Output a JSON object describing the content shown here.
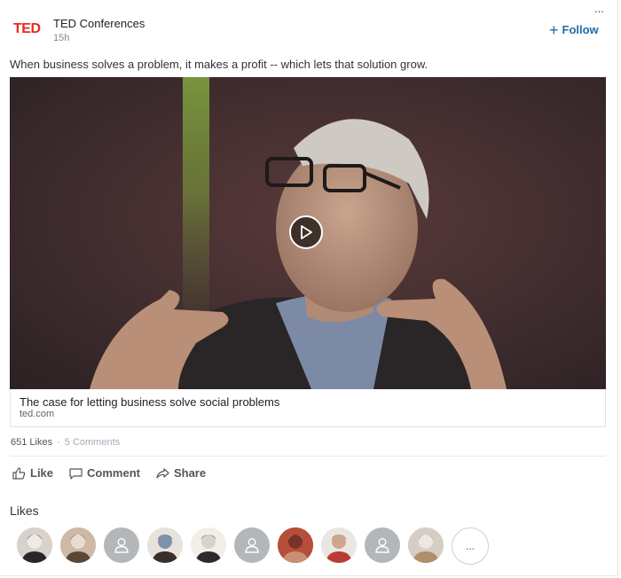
{
  "post": {
    "author_logo": "TED",
    "author_name": "TED Conferences",
    "time_ago": "15h",
    "more_label": "...",
    "follow_label": "Follow",
    "commentary": "When business solves a problem, it makes a profit -- which lets that solution grow."
  },
  "link": {
    "title": "The case for letting business solve social problems",
    "domain": "ted.com"
  },
  "social": {
    "likes_count": "651 Likes",
    "separator": "·",
    "comments_count": "5 Comments"
  },
  "actions": {
    "like": "Like",
    "comment": "Comment",
    "share": "Share"
  },
  "likes_section": {
    "heading": "Likes",
    "more_label": "...",
    "avatars": [
      {
        "kind": "photo",
        "icon": "person-photo"
      },
      {
        "kind": "photo",
        "icon": "person-photo"
      },
      {
        "kind": "placeholder",
        "icon": "person-icon"
      },
      {
        "kind": "photo",
        "icon": "person-photo"
      },
      {
        "kind": "photo",
        "icon": "person-photo"
      },
      {
        "kind": "placeholder",
        "icon": "person-icon"
      },
      {
        "kind": "photo",
        "icon": "person-photo"
      },
      {
        "kind": "photo",
        "icon": "person-photo"
      },
      {
        "kind": "placeholder",
        "icon": "person-icon"
      },
      {
        "kind": "photo",
        "icon": "person-photo"
      }
    ]
  },
  "colors": {
    "brand_red": "#e62b1e",
    "link_blue": "#1f6ca8",
    "placeholder_gray": "#b4b7ba"
  }
}
